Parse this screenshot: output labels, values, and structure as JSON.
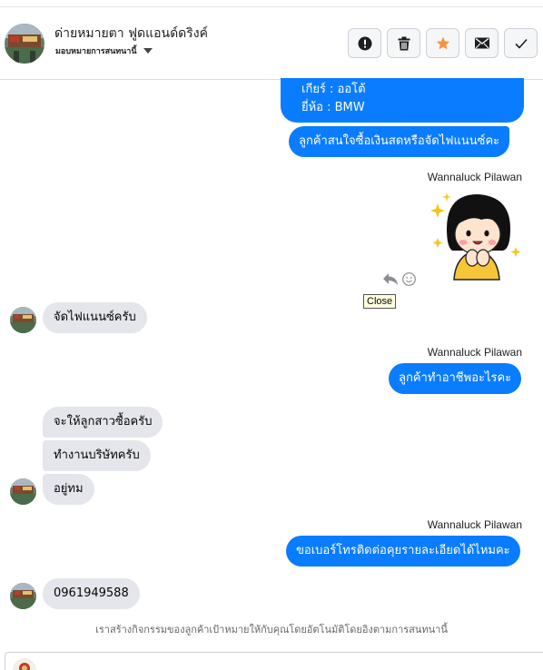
{
  "header": {
    "title": "ด่ายหมายตา ฟูดแอนด์ดริงค์",
    "assignment_label": "มอบหมายการสนทนานี้",
    "actions": [
      {
        "name": "report-button",
        "icon": "exclamation-icon"
      },
      {
        "name": "delete-button",
        "icon": "trash-icon"
      },
      {
        "name": "star-button",
        "icon": "star-icon",
        "color": "#f7923b"
      },
      {
        "name": "mail-button",
        "icon": "envelope-icon"
      },
      {
        "name": "done-button",
        "icon": "checkmark-icon"
      }
    ]
  },
  "messages": {
    "out_partial_line1": "เกียร์ : ออโต้",
    "out_partial_line2": "ยี่ห้อ : BMW",
    "out_interest": "ลูกค้าสนใจซื้อเงินสดหรือจัดไฟแนนซ์คะ",
    "sender_name": "Wannaluck Pilawan",
    "in_finance": "จัดไฟแนนซ์ครับ",
    "out_occupation": "ลูกค้าทำอาชีพอะไรคะ",
    "in_daughter": "จะให้ลูกสาวซื้อครับ",
    "in_company": "ทำงานบริษัทครับ",
    "in_dunno": "อยู่ทม",
    "out_phone": "ขอเบอร์โทรติดต่อคุยรายละเอียดได้ไหมคะ",
    "in_phone": "0961949588"
  },
  "tooltip": "Close",
  "notice": "เราสร้างกิจกรรมของลูกค้าเป้าหมายให้กับคุณโดยอัตโนมัติโดยอิงตามการสนทนานี้",
  "colors": {
    "outgoing_bubble": "#0a7cff",
    "incoming_bubble": "#e4e6eb",
    "star": "#f7923b"
  }
}
